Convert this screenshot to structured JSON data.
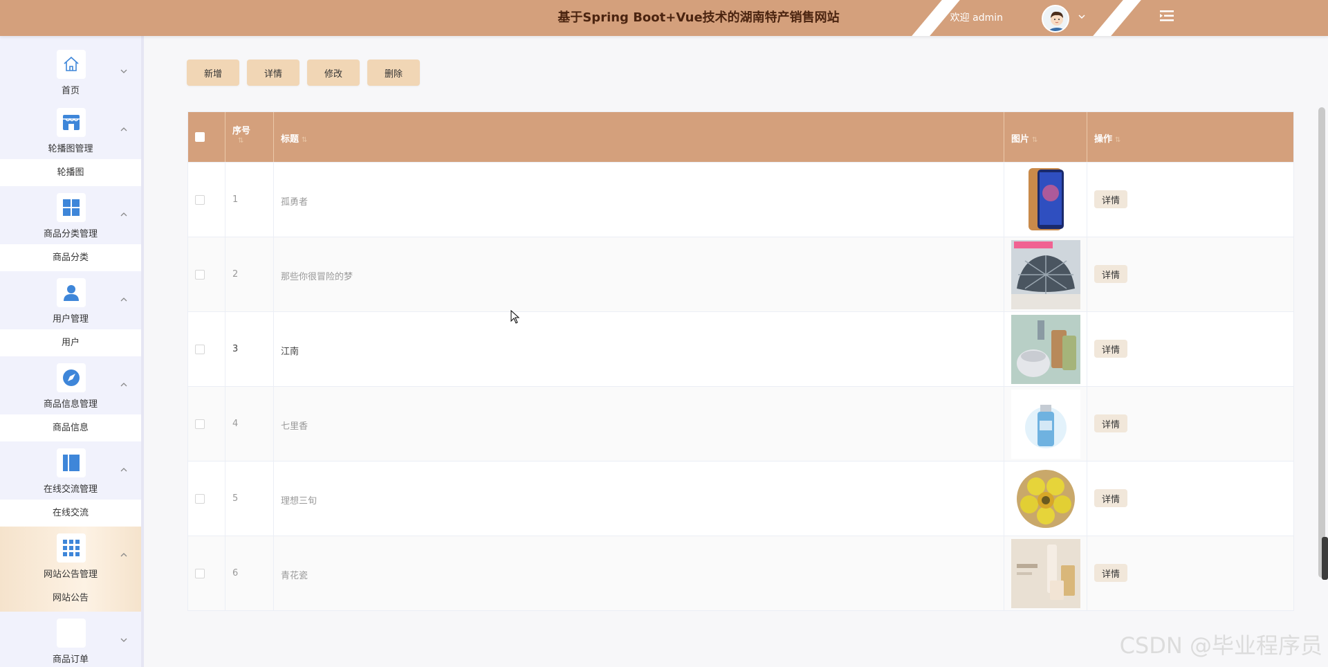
{
  "header": {
    "title": "基于Spring Boot+Vue技术的湖南特产销售网站",
    "welcome": "欢迎 admin"
  },
  "sidebar": {
    "groups": [
      {
        "label": "首页",
        "icon": "home-icon",
        "submenu": ""
      },
      {
        "label": "轮播图管理",
        "icon": "store-icon",
        "submenu": "轮播图"
      },
      {
        "label": "商品分类管理",
        "icon": "grid-icon",
        "submenu": "商品分类"
      },
      {
        "label": "用户管理",
        "icon": "user-icon",
        "submenu": "用户"
      },
      {
        "label": "商品信息管理",
        "icon": "compass-icon",
        "submenu": "商品信息"
      },
      {
        "label": "在线交流管理",
        "icon": "book-icon",
        "submenu": "在线交流"
      },
      {
        "label": "网站公告管理",
        "icon": "apps-icon",
        "submenu": "网站公告"
      },
      {
        "label": "商品订单",
        "icon": "blank-icon",
        "submenu": ""
      }
    ]
  },
  "toolbar": {
    "add_label": "新增",
    "detail_label": "详情",
    "edit_label": "修改",
    "delete_label": "删除"
  },
  "table": {
    "headers": {
      "seq": "序号",
      "title": "标题",
      "image": "图片",
      "action": "操作"
    },
    "rows": [
      {
        "seq": "1",
        "title": "孤勇者",
        "image": "phone-image",
        "action": "详情"
      },
      {
        "seq": "2",
        "title": "那些你很冒险的梦",
        "image": "pillow-image",
        "action": "详情"
      },
      {
        "seq": "3",
        "title": "江南",
        "image": "cups-image",
        "action": "详情"
      },
      {
        "seq": "4",
        "title": "七里香",
        "image": "bottle-image",
        "action": "详情"
      },
      {
        "seq": "5",
        "title": "理想三旬",
        "image": "lemons-image",
        "action": "详情"
      },
      {
        "seq": "6",
        "title": "青花瓷",
        "image": "cosmetics-image",
        "action": "详情"
      }
    ]
  },
  "watermark": "CSDN @毕业程序员",
  "colors": {
    "header": "#d4a07c",
    "sidebar": "#f1f2fc",
    "button": "#f1d6b5",
    "icon": "#3e86d9"
  }
}
